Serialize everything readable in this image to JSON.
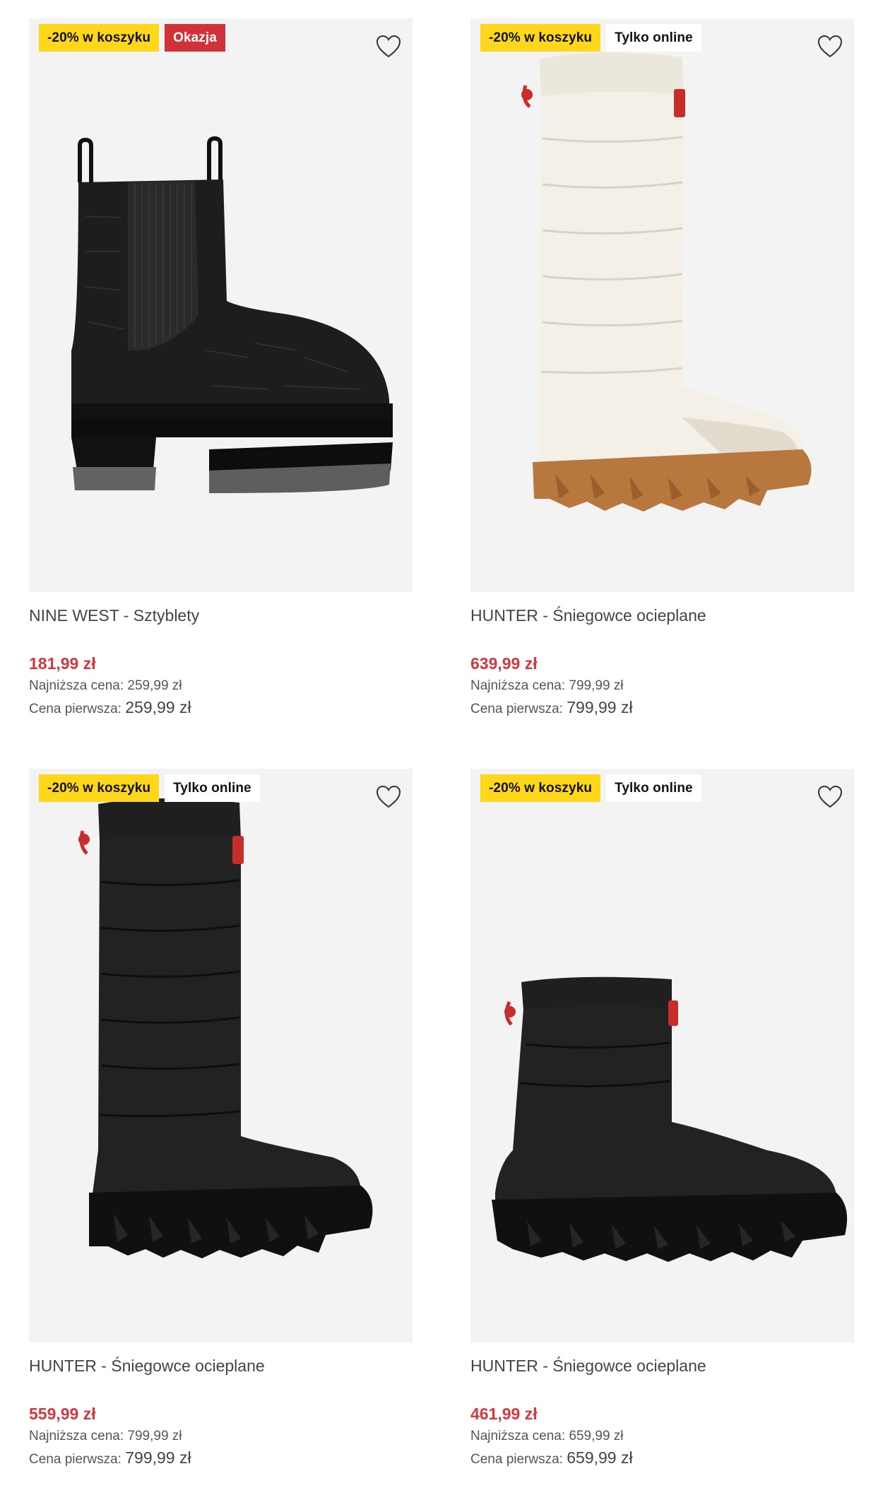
{
  "products": [
    {
      "badges": [
        {
          "text": "-20% w koszyku",
          "kind": "promo"
        },
        {
          "text": "Okazja",
          "kind": "deal"
        }
      ],
      "title": "NINE WEST - Sztyblety",
      "price": "181,99 zł",
      "lowest_label": "Najniższa cena:",
      "lowest_value": "259,99 zł",
      "first_label": "Cena pierwsza:",
      "first_value": "259,99 zł",
      "image": "black-chelsea-boot"
    },
    {
      "badges": [
        {
          "text": "-20% w koszyku",
          "kind": "promo"
        },
        {
          "text": "Tylko online",
          "kind": "online"
        }
      ],
      "title": "HUNTER - Śniegowce ocieplane",
      "price": "639,99 zł",
      "lowest_label": "Najniższa cena:",
      "lowest_value": "799,99 zł",
      "first_label": "Cena pierwsza:",
      "first_value": "799,99 zł",
      "image": "cream-tall-snow-boot"
    },
    {
      "badges": [
        {
          "text": "-20% w koszyku",
          "kind": "promo"
        },
        {
          "text": "Tylko online",
          "kind": "online"
        }
      ],
      "title": "HUNTER - Śniegowce ocieplane",
      "price": "559,99 zł",
      "lowest_label": "Najniższa cena:",
      "lowest_value": "799,99 zł",
      "first_label": "Cena pierwsza:",
      "first_value": "799,99 zł",
      "image": "black-tall-snow-boot"
    },
    {
      "badges": [
        {
          "text": "-20% w koszyku",
          "kind": "promo"
        },
        {
          "text": "Tylko online",
          "kind": "online"
        }
      ],
      "title": "HUNTER - Śniegowce ocieplane",
      "price": "461,99 zł",
      "lowest_label": "Najniższa cena:",
      "lowest_value": "659,99 zł",
      "first_label": "Cena pierwsza:",
      "first_value": "659,99 zł",
      "image": "black-short-snow-boot"
    }
  ],
  "icons": {
    "favorite": "heart-outline-icon"
  },
  "colors": {
    "promo_badge": "#ffd71a",
    "deal_badge": "#d1323a",
    "sale_price": "#d4373f",
    "image_bg": "#f3f3f3"
  }
}
